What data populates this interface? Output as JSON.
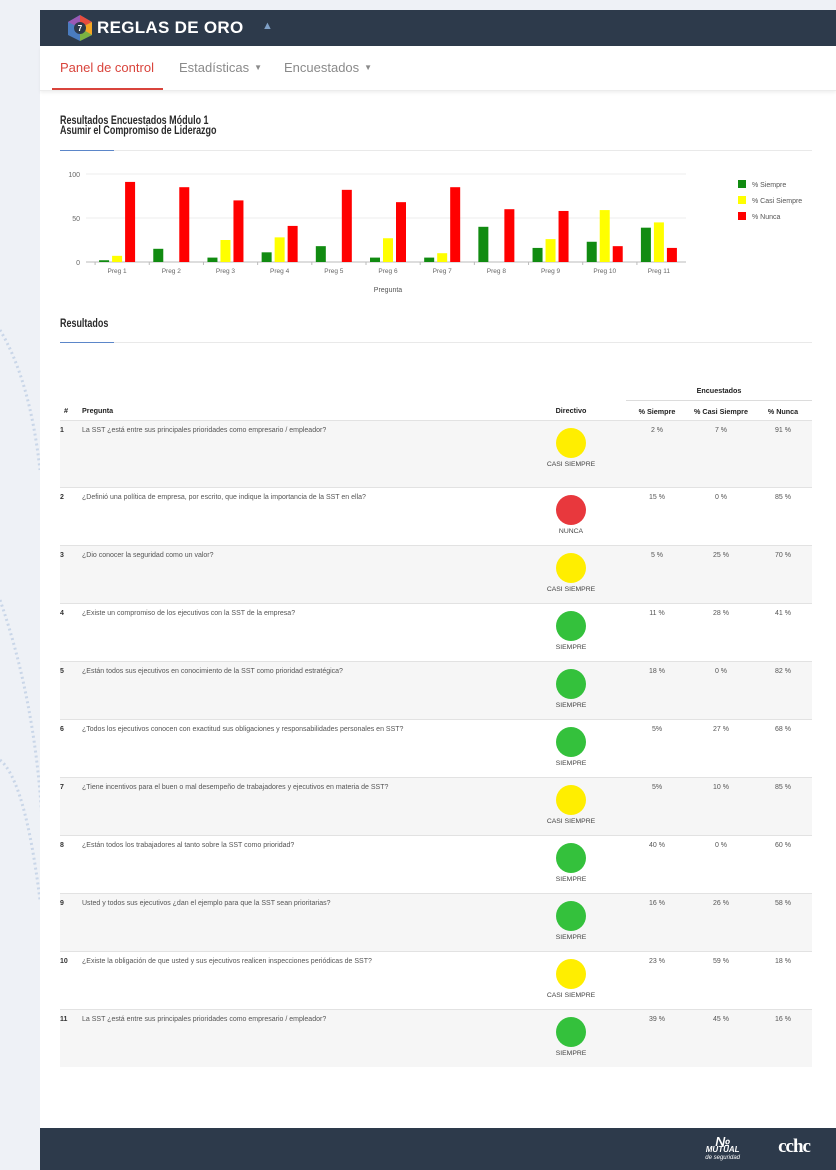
{
  "app": {
    "title": "REGLAS DE ORO",
    "logo_badge": "7"
  },
  "nav": {
    "items": [
      {
        "label": "Panel de control",
        "active": true
      },
      {
        "label": "Estadísticas",
        "dropdown": true
      },
      {
        "label": "Encuestados",
        "dropdown": true
      }
    ]
  },
  "header": {
    "line1": "Resultados Encuestados Módulo 1",
    "line2": "Asumir el Compromiso de Liderazgo"
  },
  "colors": {
    "siempre": "#118b11",
    "casi": "#ffff00",
    "nunca": "#ff0000",
    "dot_yellow": "#ffee00",
    "dot_red": "#e8383d",
    "dot_green": "#34c13c"
  },
  "chart_data": {
    "type": "bar",
    "xlabel": "Pregunta",
    "ylabel": "",
    "ylim": [
      0,
      100
    ],
    "yticks": [
      0,
      50,
      100
    ],
    "grid": true,
    "legend_position": "right",
    "categories": [
      "Preg 1",
      "Preg 2",
      "Preg 3",
      "Preg 4",
      "Preg 5",
      "Preg 6",
      "Preg 7",
      "Preg 8",
      "Preg 9",
      "Preg 10",
      "Preg 11"
    ],
    "series": [
      {
        "name": "% Siempre",
        "color": "#118b11",
        "values": [
          2,
          15,
          5,
          11,
          18,
          5,
          5,
          40,
          16,
          23,
          39
        ]
      },
      {
        "name": "% Casi Siempre",
        "color": "#ffff00",
        "values": [
          7,
          0,
          25,
          28,
          0,
          27,
          10,
          0,
          26,
          59,
          45
        ]
      },
      {
        "name": "% Nunca",
        "color": "#ff0000",
        "values": [
          91,
          85,
          70,
          41,
          82,
          68,
          85,
          60,
          58,
          18,
          16
        ]
      }
    ]
  },
  "results": {
    "title": "Resultados",
    "group_header": "Encuestados",
    "columns": {
      "num": "#",
      "question": "Pregunta",
      "directivo": "Directivo",
      "siempre": "% Siempre",
      "casi": "% Casi Siempre",
      "nunca": "% Nunca"
    },
    "rows": [
      {
        "n": "1",
        "q": "La SST ¿está entre sus principales prioridades como empresario / empleador?",
        "dir": "CASI SIEMPRE",
        "level": "yellow",
        "s": "2 %",
        "c": "7 %",
        "nu": "91 %"
      },
      {
        "n": "2",
        "q": "¿Definió una política de empresa, por escrito, que indique la importancia de la SST en ella?",
        "dir": "NUNCA",
        "level": "red",
        "s": "15 %",
        "c": "0 %",
        "nu": "85 %"
      },
      {
        "n": "3",
        "q": "¿Dio conocer la seguridad como un valor?",
        "dir": "CASI SIEMPRE",
        "level": "yellow",
        "s": "5 %",
        "c": "25 %",
        "nu": "70 %"
      },
      {
        "n": "4",
        "q": "¿Existe un compromiso de los ejecutivos con la SST de la empresa?",
        "dir": "SIEMPRE",
        "level": "green",
        "s": "11 %",
        "c": "28 %",
        "nu": "41 %"
      },
      {
        "n": "5",
        "q": "¿Están todos sus ejecutivos en conocimiento de la SST como prioridad estratégica?",
        "dir": "SIEMPRE",
        "level": "green",
        "s": "18 %",
        "c": "0 %",
        "nu": "82 %"
      },
      {
        "n": "6",
        "q": "¿Todos los ejecutivos conocen con exactitud sus obligaciones y responsabilidades personales en SST?",
        "dir": "SIEMPRE",
        "level": "green",
        "s": "5%",
        "c": "27 %",
        "nu": "68 %"
      },
      {
        "n": "7",
        "q": "¿Tiene incentivos para el buen o mal desempeño de trabajadores y ejecutivos en materia de SST?",
        "dir": "CASI SIEMPRE",
        "level": "yellow",
        "s": "5%",
        "c": "10 %",
        "nu": "85 %"
      },
      {
        "n": "8",
        "q": "¿Están todos los trabajadores al tanto sobre la SST como prioridad?",
        "dir": "SIEMPRE",
        "level": "green",
        "s": "40 %",
        "c": "0 %",
        "nu": "60 %"
      },
      {
        "n": "9",
        "q": "Usted y todos sus ejecutivos ¿dan el ejemplo para que la SST sean prioritarias?",
        "dir": "SIEMPRE",
        "level": "green",
        "s": "16 %",
        "c": "26 %",
        "nu": "58 %"
      },
      {
        "n": "10",
        "q": "¿Existe la obligación de que usted y sus ejecutivos realicen inspecciones periódicas de SST?",
        "dir": "CASI SIEMPRE",
        "level": "yellow",
        "s": "23 %",
        "c": "59 %",
        "nu": "18 %"
      },
      {
        "n": "11",
        "q": "La SST ¿está entre sus principales prioridades como empresario / empleador?",
        "dir": "SIEMPRE",
        "level": "green",
        "s": "39 %",
        "c": "45 %",
        "nu": "16 %"
      }
    ]
  },
  "footer": {
    "brand1_line1": "MUTUAL",
    "brand1_line2": "de seguridad",
    "brand2": "cchc"
  }
}
